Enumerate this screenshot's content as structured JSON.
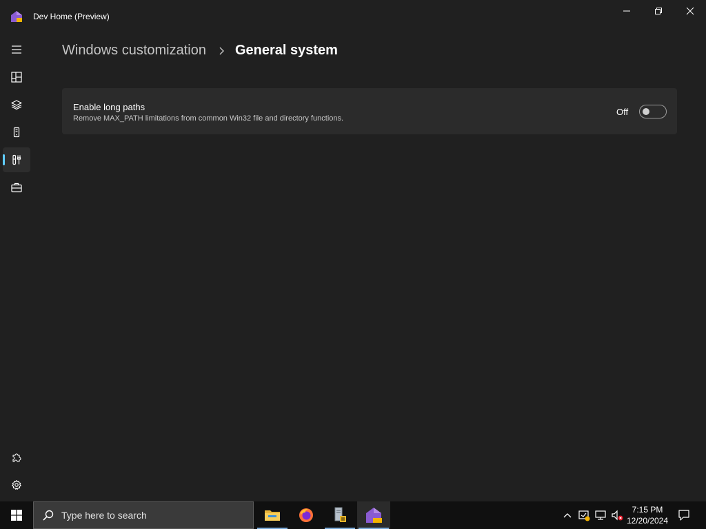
{
  "window": {
    "title": "Dev Home (Preview)"
  },
  "nav": {
    "items": [
      {
        "name": "dashboard",
        "icon": "dashboard-icon"
      },
      {
        "name": "machine-configuration",
        "icon": "layers-icon"
      },
      {
        "name": "environments",
        "icon": "device-icon"
      },
      {
        "name": "windows-customization",
        "icon": "tools-icon",
        "selected": true
      },
      {
        "name": "utilities",
        "icon": "briefcase-icon"
      }
    ],
    "footer": [
      {
        "name": "extensions",
        "icon": "puzzle-icon"
      },
      {
        "name": "settings",
        "icon": "gear-icon"
      }
    ]
  },
  "breadcrumb": {
    "parent": "Windows customization",
    "current": "General system"
  },
  "setting": {
    "title": "Enable long paths",
    "description": "Remove MAX_PATH limitations from common Win32 file and directory functions.",
    "state_label": "Off",
    "enabled": false
  },
  "taskbar": {
    "search_placeholder": "Type here to search",
    "apps": [
      "file-explorer",
      "firefox",
      "file-server-manager",
      "dev-home"
    ],
    "time": "7:15 PM",
    "date": "12/20/2024",
    "accent": "#60cdff"
  }
}
